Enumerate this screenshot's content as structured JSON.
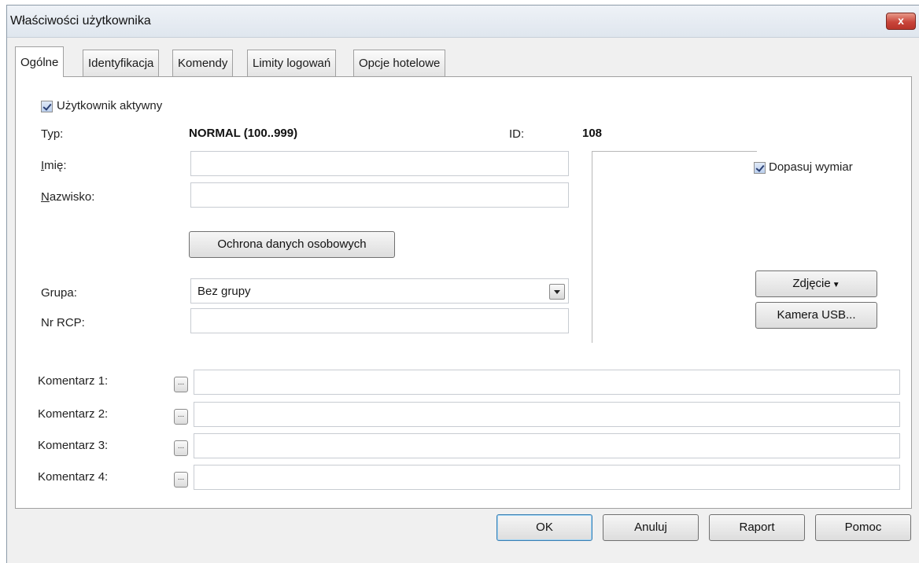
{
  "window": {
    "title": "Właściwości użytkownika",
    "close_label": "x"
  },
  "tabs": [
    {
      "label": "Ogólne",
      "active": true
    },
    {
      "label": "Identyfikacja"
    },
    {
      "label": "Komendy"
    },
    {
      "label": "Limity logowań"
    },
    {
      "label": "Opcje hotelowe"
    }
  ],
  "general": {
    "active_label": "Użytkownik aktywny",
    "active_checked": true,
    "type_label": "Typ:",
    "type_value": "NORMAL (100..999)",
    "id_label": "ID:",
    "id_value": "108",
    "first_name_label_ul": "I",
    "first_name_label_rest": "mię:",
    "first_name_value": "",
    "last_name_label_ul": "N",
    "last_name_label_rest": "azwisko:",
    "last_name_value": "",
    "privacy_button": "Ochrona danych osobowych",
    "group_label": "Grupa:",
    "group_value": "Bez grupy",
    "rcp_label": "Nr RCP:",
    "rcp_value": "",
    "fit_size_label": "Dopasuj wymiar",
    "fit_size_checked": true,
    "photo_button": "Zdjęcie",
    "usb_camera_button": "Kamera USB...",
    "comments": [
      {
        "label": "Komentarz 1:",
        "value": ""
      },
      {
        "label": "Komentarz 2:",
        "value": ""
      },
      {
        "label": "Komentarz 3:",
        "value": ""
      },
      {
        "label": "Komentarz 4:",
        "value": ""
      }
    ],
    "ellipsis": "..."
  },
  "footer": {
    "ok": "OK",
    "cancel": "Anuluj",
    "report": "Raport",
    "help": "Pomoc"
  }
}
